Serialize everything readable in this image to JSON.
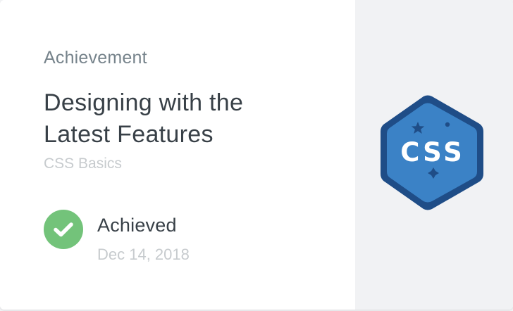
{
  "achievement": {
    "eyebrow": "Achievement",
    "title": "Designing with the Latest Features",
    "course": "CSS Basics",
    "status": "Achieved",
    "date": "Dec 14, 2018"
  },
  "badge": {
    "text": "CSS",
    "icon": "css-hexagon-badge",
    "colors": {
      "outer": "#1f4d87",
      "inner": "#3b82c6",
      "text": "#ffffff"
    }
  },
  "icons": {
    "status": "check-icon"
  },
  "colors": {
    "success": "#73c37a",
    "text": "#384047",
    "muted": "#c7cbce",
    "eyebrow": "#76838b",
    "panel": "#f1f2f4"
  }
}
